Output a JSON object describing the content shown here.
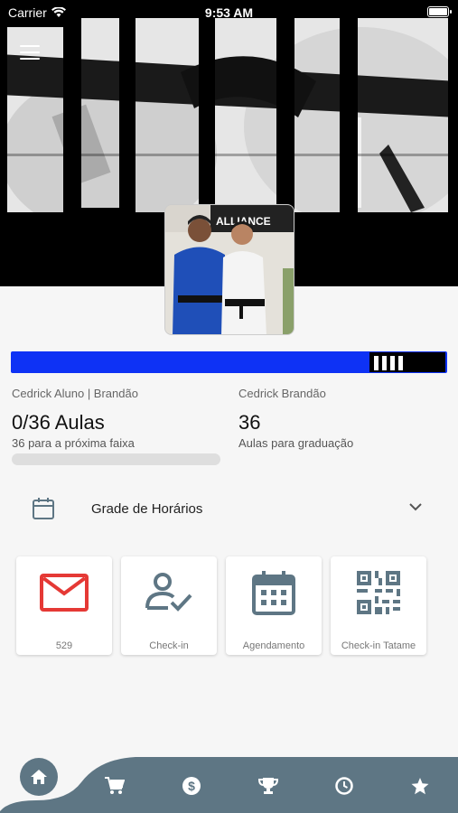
{
  "status_bar": {
    "carrier": "Carrier",
    "time": "9:53 AM"
  },
  "banner": {
    "logo_text": "ALLIANCE"
  },
  "belt": {
    "color": "#0e32f5",
    "stripes": 4
  },
  "student": {
    "name": "Cedrick Aluno | Brandão",
    "classes_count": "0/36 Aulas",
    "next_belt_text": "36 para a próxima faixa",
    "progress_fraction": 0
  },
  "instructor": {
    "name": "Cedrick Brandão",
    "classes_total": "36",
    "label": "Aulas para graduação"
  },
  "schedule": {
    "label": "Grade de Horários"
  },
  "cards": [
    {
      "label": "529",
      "icon": "mail-icon",
      "color": "#e53935"
    },
    {
      "label": "Check-in",
      "icon": "user-check-icon",
      "color": "#5e7684"
    },
    {
      "label": "Agendamento",
      "icon": "calendar-icon",
      "color": "#5e7684"
    },
    {
      "label": "Check-in Tatame",
      "icon": "qr-code-icon",
      "color": "#5e7684"
    }
  ],
  "nav": {
    "accent": "#5e7684",
    "items": [
      "home-icon",
      "cart-icon",
      "dollar-icon",
      "trophy-icon",
      "clock-icon",
      "star-icon"
    ]
  }
}
